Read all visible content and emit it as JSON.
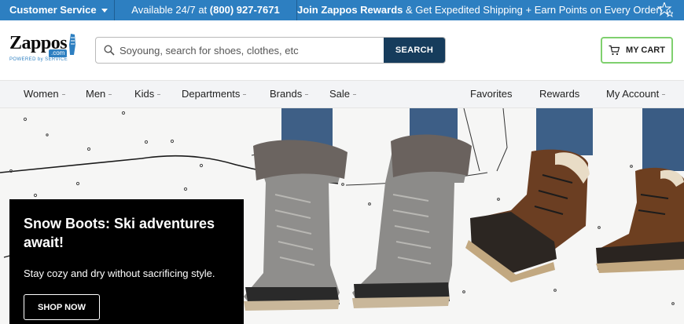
{
  "topbar": {
    "customer_service": "Customer Service",
    "available_prefix": "Available 24/7 at",
    "phone": "(800) 927-7671",
    "rewards_bold": "Join Zappos Rewards",
    "rewards_rest": "& Get Expedited Shipping + Earn Points on Every Order!"
  },
  "header": {
    "logo_word": "Zappos",
    "logo_dotcom": ".com",
    "logo_tagline": "POWERED by SERVICE",
    "search_placeholder": "Soyoung, search for shoes, clothes, etc",
    "search_button": "SEARCH",
    "cart_label": "MY CART"
  },
  "nav": {
    "left": [
      "Women",
      "Men",
      "Kids",
      "Departments",
      "Brands",
      "Sale"
    ],
    "right": [
      "Favorites",
      "Rewards",
      "My Account"
    ]
  },
  "hero": {
    "title": "Snow Boots: Ski adventures await!",
    "subtitle": "Stay cozy and dry without sacrificing style.",
    "cta": "SHOP NOW"
  },
  "colors": {
    "topbar": "#2d7fc1",
    "search_button": "#163c5c",
    "cart_border": "#7fd06e"
  }
}
